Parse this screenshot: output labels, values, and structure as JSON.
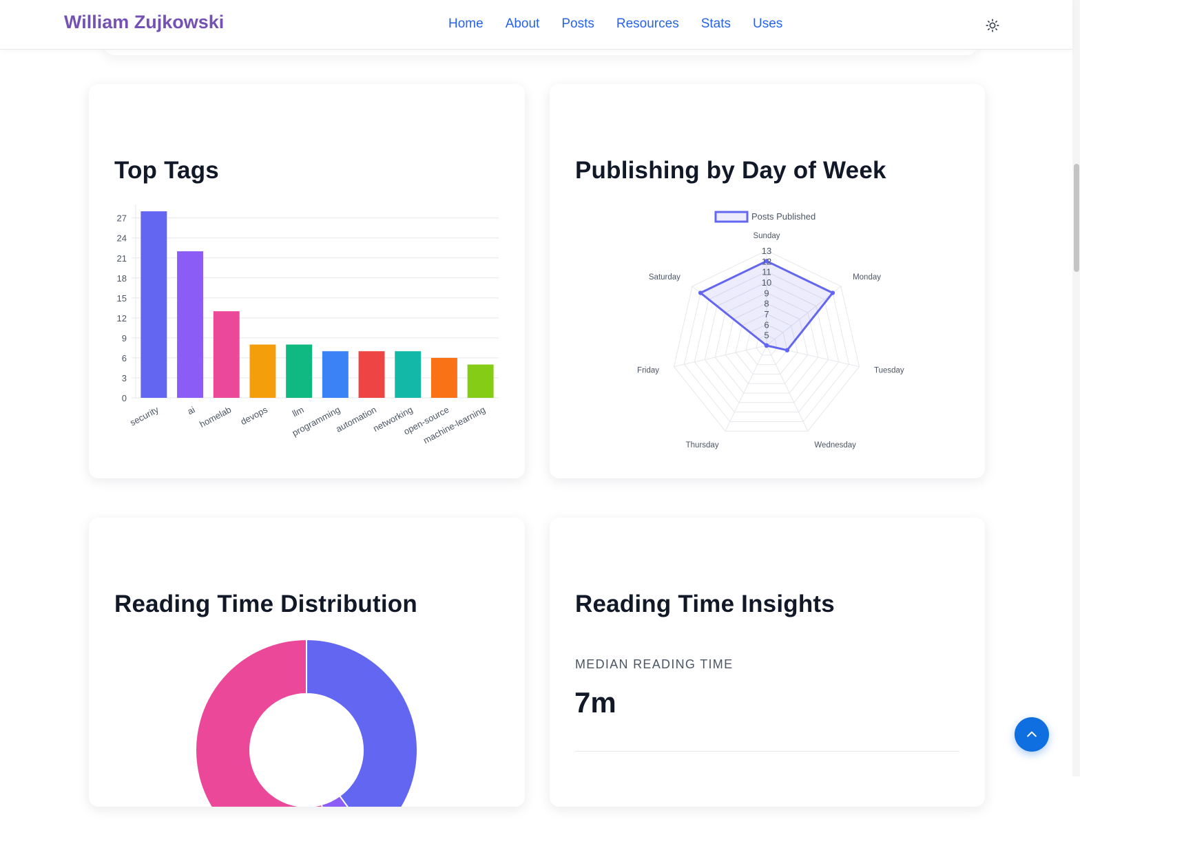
{
  "site": {
    "title": "William Zujkowski"
  },
  "nav": {
    "items": [
      {
        "label": "Home"
      },
      {
        "label": "About"
      },
      {
        "label": "Posts"
      },
      {
        "label": "Resources"
      },
      {
        "label": "Stats"
      },
      {
        "label": "Uses"
      }
    ]
  },
  "icons": {
    "theme_toggle": "sun-icon",
    "back_to_top": "chevron-up-icon"
  },
  "cards": {
    "top_tags": {
      "title": "Top Tags"
    },
    "publishing": {
      "title": "Publishing by Day of Week"
    },
    "reading_dist": {
      "title": "Reading Time Distribution"
    },
    "insights": {
      "title": "Reading Time Insights",
      "median_label": "MEDIAN READING TIME",
      "median_value": "7m"
    }
  },
  "colors": {
    "brand": "#7452b4",
    "nav_link": "#2563eb",
    "radar_line": "#6366f1",
    "back_to_top": "#0f6ee0"
  },
  "chart_data": [
    {
      "type": "bar",
      "title": "Top Tags",
      "categories": [
        "security",
        "ai",
        "homelab",
        "devops",
        "llm",
        "programming",
        "automation",
        "networking",
        "open-source",
        "machine-learning"
      ],
      "values": [
        28,
        22,
        13,
        8,
        8,
        7,
        7,
        7,
        6,
        5
      ],
      "colors": [
        "#6366f1",
        "#8b5cf6",
        "#ec4899",
        "#f59e0b",
        "#10b981",
        "#3b82f6",
        "#ef4444",
        "#14b8a6",
        "#f97316",
        "#84cc16"
      ],
      "yticks": [
        0,
        3,
        6,
        9,
        12,
        15,
        18,
        21,
        24,
        27
      ],
      "ylim": [
        0,
        28
      ],
      "grid": true,
      "legend": "none"
    },
    {
      "type": "radar",
      "title": "Publishing by Day of Week",
      "axes": [
        "Sunday",
        "Monday",
        "Tuesday",
        "Wednesday",
        "Thursday",
        "Friday",
        "Saturday"
      ],
      "series": [
        {
          "name": "Posts Published",
          "values": [
            12,
            12,
            6,
            4,
            4,
            4,
            12
          ]
        }
      ],
      "rticks": [
        4,
        5,
        6,
        7,
        8,
        9,
        10,
        11,
        12,
        13
      ],
      "rticks_shown": [
        "5",
        "6",
        "7",
        "8",
        "9",
        "10",
        "11",
        "12",
        "13"
      ],
      "rlim": [
        4,
        13
      ],
      "legend": "top"
    },
    {
      "type": "pie",
      "title": "Reading Time Distribution",
      "values": [
        28,
        4,
        38
      ],
      "colors": [
        "#6366f1",
        "#8b5cf6",
        "#ec4899"
      ],
      "legend": "none"
    }
  ]
}
